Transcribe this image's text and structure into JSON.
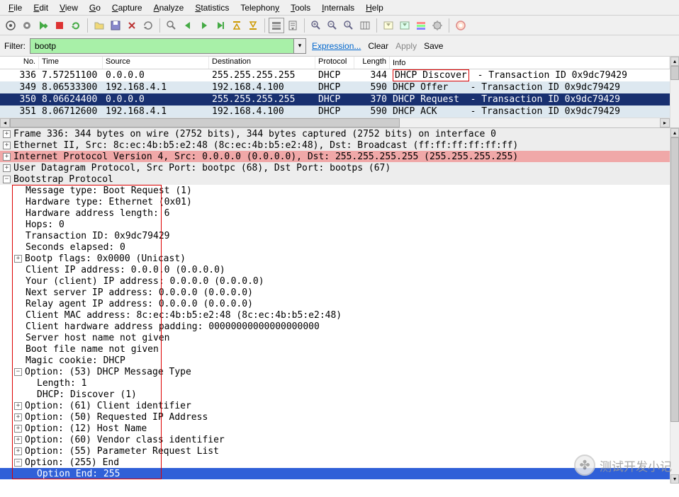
{
  "menu": {
    "items": [
      "File",
      "Edit",
      "View",
      "Go",
      "Capture",
      "Analyze",
      "Statistics",
      "Telephony",
      "Tools",
      "Internals",
      "Help"
    ]
  },
  "filter": {
    "label": "Filter:",
    "value": "bootp",
    "expression": "Expression...",
    "clear": "Clear",
    "apply": "Apply",
    "save": "Save"
  },
  "columns": {
    "no": "No.",
    "time": "Time",
    "source": "Source",
    "destination": "Destination",
    "protocol": "Protocol",
    "length": "Length",
    "info": "Info"
  },
  "packets": [
    {
      "no": "336",
      "time": "7.57251100",
      "src": "0.0.0.0",
      "dst": "255.255.255.255",
      "proto": "DHCP",
      "len": "344",
      "info_prefix": "",
      "info_main": "DHCP Discover",
      "info_rest": " - Transaction ID 0x9dc79429",
      "boxed": true,
      "cls": ""
    },
    {
      "no": "349",
      "time": "8.06533300",
      "src": "192.168.4.1",
      "dst": "192.168.4.100",
      "proto": "DHCP",
      "len": "590",
      "info_prefix": "",
      "info_main": "DHCP Offer   ",
      "info_rest": " - Transaction ID 0x9dc79429",
      "boxed": false,
      "cls": "bluealt"
    },
    {
      "no": "350",
      "time": "8.06624400",
      "src": "0.0.0.0",
      "dst": "255.255.255.255",
      "proto": "DHCP",
      "len": "370",
      "info_prefix": "",
      "info_main": "DHCP Request ",
      "info_rest": " - Transaction ID 0x9dc79429",
      "boxed": false,
      "cls": "sel"
    },
    {
      "no": "351",
      "time": "8.06712600",
      "src": "192.168.4.1",
      "dst": "192.168.4.100",
      "proto": "DHCP",
      "len": "590",
      "info_prefix": "",
      "info_main": "DHCP ACK     ",
      "info_rest": " - Transaction ID 0x9dc79429",
      "boxed": false,
      "cls": "bluealt"
    }
  ],
  "details": [
    {
      "t": "Frame 336: 344 bytes on wire (2752 bits), 344 bytes captured (2752 bits) on interface 0",
      "cls": "hl-gray",
      "icon": "+",
      "lvl": 0
    },
    {
      "t": "Ethernet II, Src: 8c:ec:4b:b5:e2:48 (8c:ec:4b:b5:e2:48), Dst: Broadcast (ff:ff:ff:ff:ff:ff)",
      "cls": "hl-gray",
      "icon": "+",
      "lvl": 0
    },
    {
      "t": "Internet Protocol Version 4, Src: 0.0.0.0 (0.0.0.0), Dst: 255.255.255.255 (255.255.255.255)",
      "cls": "hl-red",
      "icon": "+",
      "lvl": 0
    },
    {
      "t": "User Datagram Protocol, Src Port: bootpc (68), Dst Port: bootps (67)",
      "cls": "hl-gray",
      "icon": "+",
      "lvl": 0
    },
    {
      "t": "Bootstrap Protocol",
      "cls": "hl-gray",
      "icon": "-",
      "lvl": 0
    },
    {
      "t": "Message type: Boot Request (1)",
      "cls": "",
      "icon": "",
      "lvl": 1
    },
    {
      "t": "Hardware type: Ethernet (0x01)",
      "cls": "",
      "icon": "",
      "lvl": 1
    },
    {
      "t": "Hardware address length: 6",
      "cls": "",
      "icon": "",
      "lvl": 1
    },
    {
      "t": "Hops: 0",
      "cls": "",
      "icon": "",
      "lvl": 1
    },
    {
      "t": "Transaction ID: 0x9dc79429",
      "cls": "",
      "icon": "",
      "lvl": 1
    },
    {
      "t": "Seconds elapsed: 0",
      "cls": "",
      "icon": "",
      "lvl": 1
    },
    {
      "t": "Bootp flags: 0x0000 (Unicast)",
      "cls": "",
      "icon": "+",
      "lvl": 1
    },
    {
      "t": "Client IP address: 0.0.0.0 (0.0.0.0)",
      "cls": "",
      "icon": "",
      "lvl": 1
    },
    {
      "t": "Your (client) IP address: 0.0.0.0 (0.0.0.0)",
      "cls": "",
      "icon": "",
      "lvl": 1
    },
    {
      "t": "Next server IP address: 0.0.0.0 (0.0.0.0)",
      "cls": "",
      "icon": "",
      "lvl": 1
    },
    {
      "t": "Relay agent IP address: 0.0.0.0 (0.0.0.0)",
      "cls": "",
      "icon": "",
      "lvl": 1
    },
    {
      "t": "Client MAC address: 8c:ec:4b:b5:e2:48 (8c:ec:4b:b5:e2:48)",
      "cls": "",
      "icon": "",
      "lvl": 1
    },
    {
      "t": "Client hardware address padding: 00000000000000000000",
      "cls": "",
      "icon": "",
      "lvl": 1
    },
    {
      "t": "Server host name not given",
      "cls": "",
      "icon": "",
      "lvl": 1
    },
    {
      "t": "Boot file name not given",
      "cls": "",
      "icon": "",
      "lvl": 1
    },
    {
      "t": "Magic cookie: DHCP",
      "cls": "",
      "icon": "",
      "lvl": 1
    },
    {
      "t": "Option: (53) DHCP Message Type",
      "cls": "",
      "icon": "-",
      "lvl": 1
    },
    {
      "t": "Length: 1",
      "cls": "",
      "icon": "",
      "lvl": 2
    },
    {
      "t": "DHCP: Discover (1)",
      "cls": "",
      "icon": "",
      "lvl": 2
    },
    {
      "t": "Option: (61) Client identifier",
      "cls": "",
      "icon": "+",
      "lvl": 1
    },
    {
      "t": "Option: (50) Requested IP Address",
      "cls": "",
      "icon": "+",
      "lvl": 1
    },
    {
      "t": "Option: (12) Host Name",
      "cls": "",
      "icon": "+",
      "lvl": 1
    },
    {
      "t": "Option: (60) Vendor class identifier",
      "cls": "",
      "icon": "+",
      "lvl": 1
    },
    {
      "t": "Option: (55) Parameter Request List",
      "cls": "",
      "icon": "+",
      "lvl": 1
    },
    {
      "t": "Option: (255) End",
      "cls": "",
      "icon": "-",
      "lvl": 1
    },
    {
      "t": "Option End: 255",
      "cls": "hl-blue",
      "icon": "",
      "lvl": 2
    }
  ],
  "watermark": "测试开发小记"
}
